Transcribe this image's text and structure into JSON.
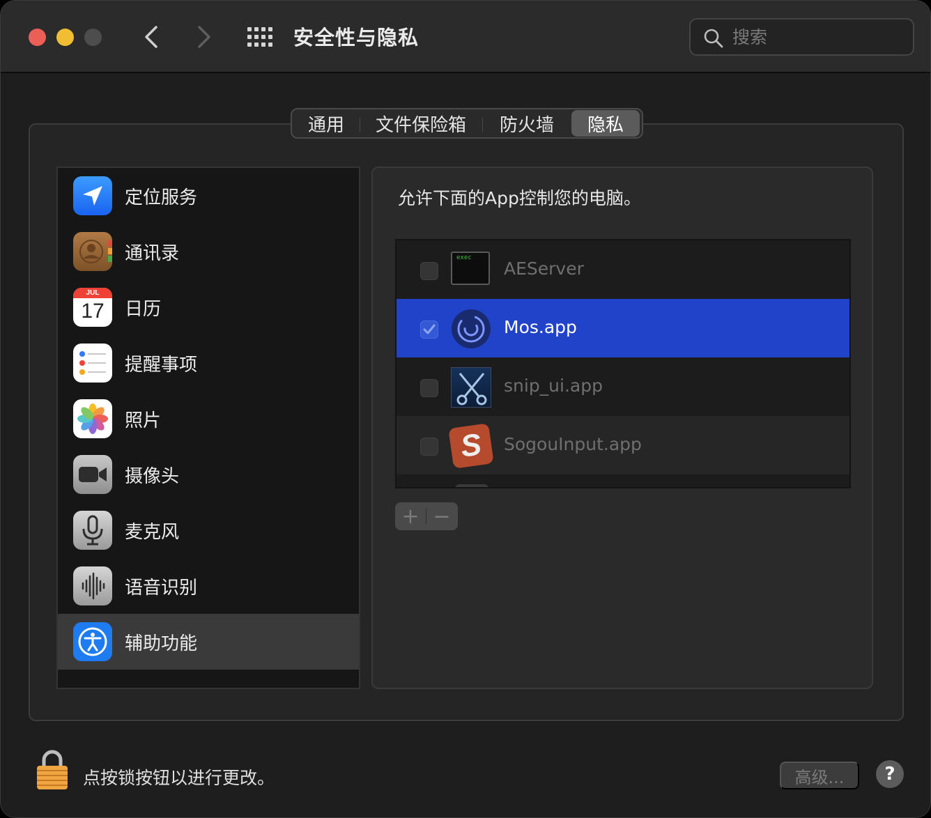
{
  "window": {
    "title": "安全性与隐私"
  },
  "search": {
    "placeholder": "搜索"
  },
  "tabs": [
    {
      "label": "通用"
    },
    {
      "label": "文件保险箱"
    },
    {
      "label": "防火墙"
    },
    {
      "label": "隐私",
      "active": true
    }
  ],
  "sidebar": {
    "items": [
      {
        "label": "定位服务",
        "icon": "location-arrow-icon"
      },
      {
        "label": "通讯录",
        "icon": "contacts-icon"
      },
      {
        "label": "日历",
        "icon": "calendar-icon",
        "cal_month": "JUL",
        "cal_day": "17"
      },
      {
        "label": "提醒事项",
        "icon": "reminders-icon"
      },
      {
        "label": "照片",
        "icon": "photos-icon"
      },
      {
        "label": "摄像头",
        "icon": "camera-icon"
      },
      {
        "label": "麦克风",
        "icon": "microphone-icon"
      },
      {
        "label": "语音识别",
        "icon": "speech-recognition-icon"
      },
      {
        "label": "辅助功能",
        "icon": "accessibility-icon",
        "selected": true
      }
    ]
  },
  "main": {
    "prompt": "允许下面的App控制您的电脑。",
    "apps": [
      {
        "name": "AEServer",
        "checked": false,
        "icon": "exec-terminal-icon",
        "icon_text": "exec"
      },
      {
        "name": "Mos.app",
        "checked": true,
        "selected": true,
        "icon": "mos-app-icon"
      },
      {
        "name": "snip_ui.app",
        "checked": false,
        "icon": "scissors-icon"
      },
      {
        "name": "SogouInput.app",
        "checked": false,
        "icon": "sogou-icon",
        "icon_text": "S"
      }
    ],
    "add_symbol": "+",
    "remove_symbol": "−"
  },
  "footer": {
    "lock_text": "点按锁按钮以进行更改。",
    "advanced_label": "高级...",
    "help_label": "?"
  },
  "colors": {
    "selection_blue": "#2043c9",
    "accessibility_blue": "#1f7cf0"
  }
}
